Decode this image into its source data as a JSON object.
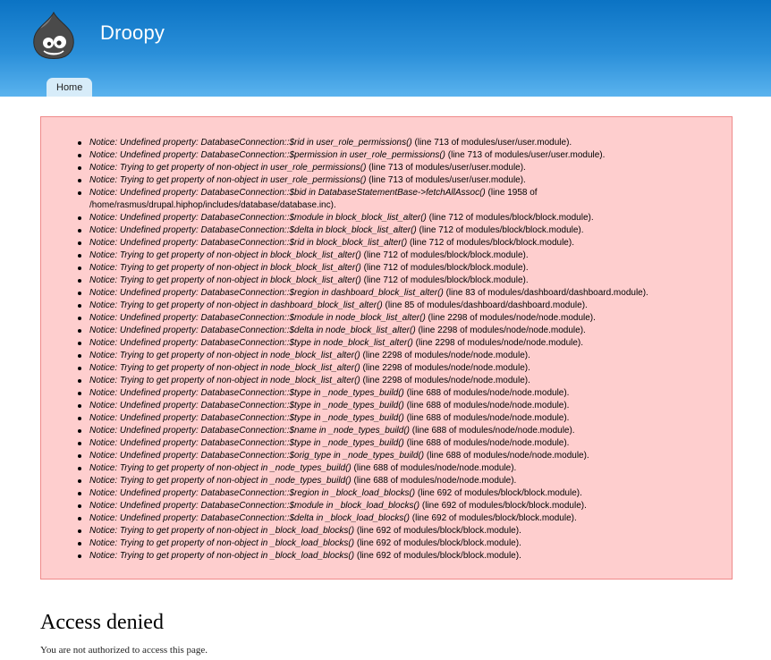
{
  "site": {
    "name": "Droopy"
  },
  "nav": {
    "tabs": [
      {
        "label": "Home"
      }
    ]
  },
  "messages": [
    {
      "text": "Notice: Undefined property: DatabaseConnection::$rid in user_role_permissions()",
      "loc": " (line 713 of modules/user/user.module)."
    },
    {
      "text": "Notice: Undefined property: DatabaseConnection::$permission in user_role_permissions()",
      "loc": " (line 713 of modules/user/user.module)."
    },
    {
      "text": "Notice: Trying to get property of non-object in user_role_permissions()",
      "loc": " (line 713 of modules/user/user.module)."
    },
    {
      "text": "Notice: Trying to get property of non-object in user_role_permissions()",
      "loc": " (line 713 of modules/user/user.module)."
    },
    {
      "text": "Notice: Undefined property: DatabaseConnection::$bid in DatabaseStatementBase->fetchAllAssoc()",
      "loc": " (line 1958 of /home/rasmus/drupal.hiphop/includes/database/database.inc)."
    },
    {
      "text": "Notice: Undefined property: DatabaseConnection::$module in block_block_list_alter()",
      "loc": " (line 712 of modules/block/block.module)."
    },
    {
      "text": "Notice: Undefined property: DatabaseConnection::$delta in block_block_list_alter()",
      "loc": " (line 712 of modules/block/block.module)."
    },
    {
      "text": "Notice: Undefined property: DatabaseConnection::$rid in block_block_list_alter()",
      "loc": " (line 712 of modules/block/block.module)."
    },
    {
      "text": "Notice: Trying to get property of non-object in block_block_list_alter()",
      "loc": " (line 712 of modules/block/block.module)."
    },
    {
      "text": "Notice: Trying to get property of non-object in block_block_list_alter()",
      "loc": " (line 712 of modules/block/block.module)."
    },
    {
      "text": "Notice: Trying to get property of non-object in block_block_list_alter()",
      "loc": " (line 712 of modules/block/block.module)."
    },
    {
      "text": "Notice: Undefined property: DatabaseConnection::$region in dashboard_block_list_alter()",
      "loc": " (line 83 of modules/dashboard/dashboard.module)."
    },
    {
      "text": "Notice: Trying to get property of non-object in dashboard_block_list_alter()",
      "loc": " (line 85 of modules/dashboard/dashboard.module)."
    },
    {
      "text": "Notice: Undefined property: DatabaseConnection::$module in node_block_list_alter()",
      "loc": " (line 2298 of modules/node/node.module)."
    },
    {
      "text": "Notice: Undefined property: DatabaseConnection::$delta in node_block_list_alter()",
      "loc": " (line 2298 of modules/node/node.module)."
    },
    {
      "text": "Notice: Undefined property: DatabaseConnection::$type in node_block_list_alter()",
      "loc": " (line 2298 of modules/node/node.module)."
    },
    {
      "text": "Notice: Trying to get property of non-object in node_block_list_alter()",
      "loc": " (line 2298 of modules/node/node.module)."
    },
    {
      "text": "Notice: Trying to get property of non-object in node_block_list_alter()",
      "loc": " (line 2298 of modules/node/node.module)."
    },
    {
      "text": "Notice: Trying to get property of non-object in node_block_list_alter()",
      "loc": " (line 2298 of modules/node/node.module)."
    },
    {
      "text": "Notice: Undefined property: DatabaseConnection::$type in _node_types_build()",
      "loc": " (line 688 of modules/node/node.module)."
    },
    {
      "text": "Notice: Undefined property: DatabaseConnection::$type in _node_types_build()",
      "loc": " (line 688 of modules/node/node.module)."
    },
    {
      "text": "Notice: Undefined property: DatabaseConnection::$type in _node_types_build()",
      "loc": " (line 688 of modules/node/node.module)."
    },
    {
      "text": "Notice: Undefined property: DatabaseConnection::$name in _node_types_build()",
      "loc": " (line 688 of modules/node/node.module)."
    },
    {
      "text": "Notice: Undefined property: DatabaseConnection::$type in _node_types_build()",
      "loc": " (line 688 of modules/node/node.module)."
    },
    {
      "text": "Notice: Undefined property: DatabaseConnection::$orig_type in _node_types_build()",
      "loc": " (line 688 of modules/node/node.module)."
    },
    {
      "text": "Notice: Trying to get property of non-object in _node_types_build()",
      "loc": " (line 688 of modules/node/node.module)."
    },
    {
      "text": "Notice: Trying to get property of non-object in _node_types_build()",
      "loc": " (line 688 of modules/node/node.module)."
    },
    {
      "text": "Notice: Undefined property: DatabaseConnection::$region in _block_load_blocks()",
      "loc": " (line 692 of modules/block/block.module)."
    },
    {
      "text": "Notice: Undefined property: DatabaseConnection::$module in _block_load_blocks()",
      "loc": " (line 692 of modules/block/block.module)."
    },
    {
      "text": "Notice: Undefined property: DatabaseConnection::$delta in _block_load_blocks()",
      "loc": " (line 692 of modules/block/block.module)."
    },
    {
      "text": "Notice: Trying to get property of non-object in _block_load_blocks()",
      "loc": " (line 692 of modules/block/block.module)."
    },
    {
      "text": "Notice: Trying to get property of non-object in _block_load_blocks()",
      "loc": " (line 692 of modules/block/block.module)."
    },
    {
      "text": "Notice: Trying to get property of non-object in _block_load_blocks()",
      "loc": " (line 692 of modules/block/block.module)."
    }
  ],
  "page": {
    "title": "Access denied",
    "body": "You are not authorized to access this page."
  },
  "icons": {
    "logo": "drupal-drop-logo-icon"
  },
  "colors": {
    "header_top": "#0b73c4",
    "header_bottom": "#5ab3ee",
    "tab_bg": "#d7ecf9",
    "error_bg": "#fecece",
    "error_border": "#ef8a8a"
  }
}
